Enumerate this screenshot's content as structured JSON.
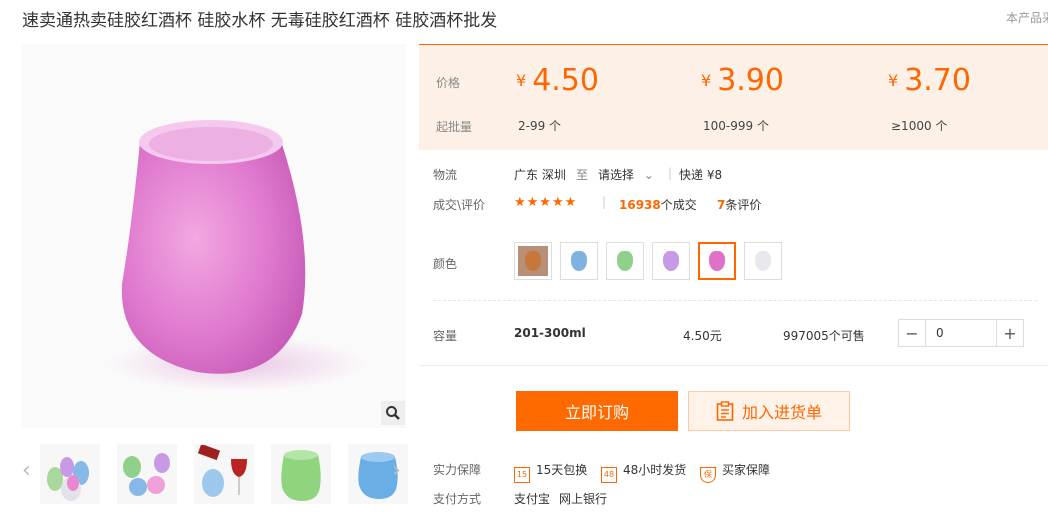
{
  "title": "速卖通热卖硅胶红酒杯 硅胶水杯 无毒硅胶红酒杯 硅胶酒杯批发",
  "note": "本产品采",
  "price": {
    "label_price": "价格",
    "label_moq": "起批量",
    "currency": "¥",
    "tiers": [
      {
        "price": "4.50",
        "qty": "2-99 个"
      },
      {
        "price": "3.90",
        "qty": "100-999 个"
      },
      {
        "price": "3.70",
        "qty": "≥1000 个"
      }
    ]
  },
  "logistics": {
    "label": "物流",
    "origin": "广东 深圳",
    "to": "至",
    "dest": "请选择",
    "shipping": "快递 ¥8"
  },
  "deals": {
    "label": "成交\\评价",
    "stars": "★★★★★",
    "sold_num": "16938",
    "sold_unit": "个成交",
    "review_num": "7",
    "review_unit": "条评价"
  },
  "color": {
    "label": "颜色",
    "swatches": [
      "#c8773a",
      "#7fb2e0",
      "#8fd08a",
      "#c79ae8",
      "#e070c8",
      "#e8e8ee"
    ],
    "selected": 4
  },
  "capacity": {
    "label": "容量",
    "value": "201-300ml",
    "price": "4.50元",
    "stock": "997005个可售",
    "quantity": "0",
    "minus": "−",
    "plus": "+"
  },
  "actions": {
    "buy": "立即订购",
    "cart": "加入进货单"
  },
  "guarantee": {
    "label": "实力保障",
    "items": [
      {
        "badge": "15",
        "text": "15天包换"
      },
      {
        "badge": "48",
        "text": "48小时发货"
      },
      {
        "badge": "保",
        "text": "买家保障"
      }
    ]
  },
  "payment": {
    "label": "支付方式",
    "methods": [
      "支付宝",
      "网上银行"
    ]
  },
  "thumbnails": [
    "cups-stack",
    "colored-cups",
    "wine-pour",
    "green-cup",
    "blue-cup"
  ],
  "colors": {
    "accent": "#ff6a00",
    "price_bg": "#fdf0e6"
  }
}
